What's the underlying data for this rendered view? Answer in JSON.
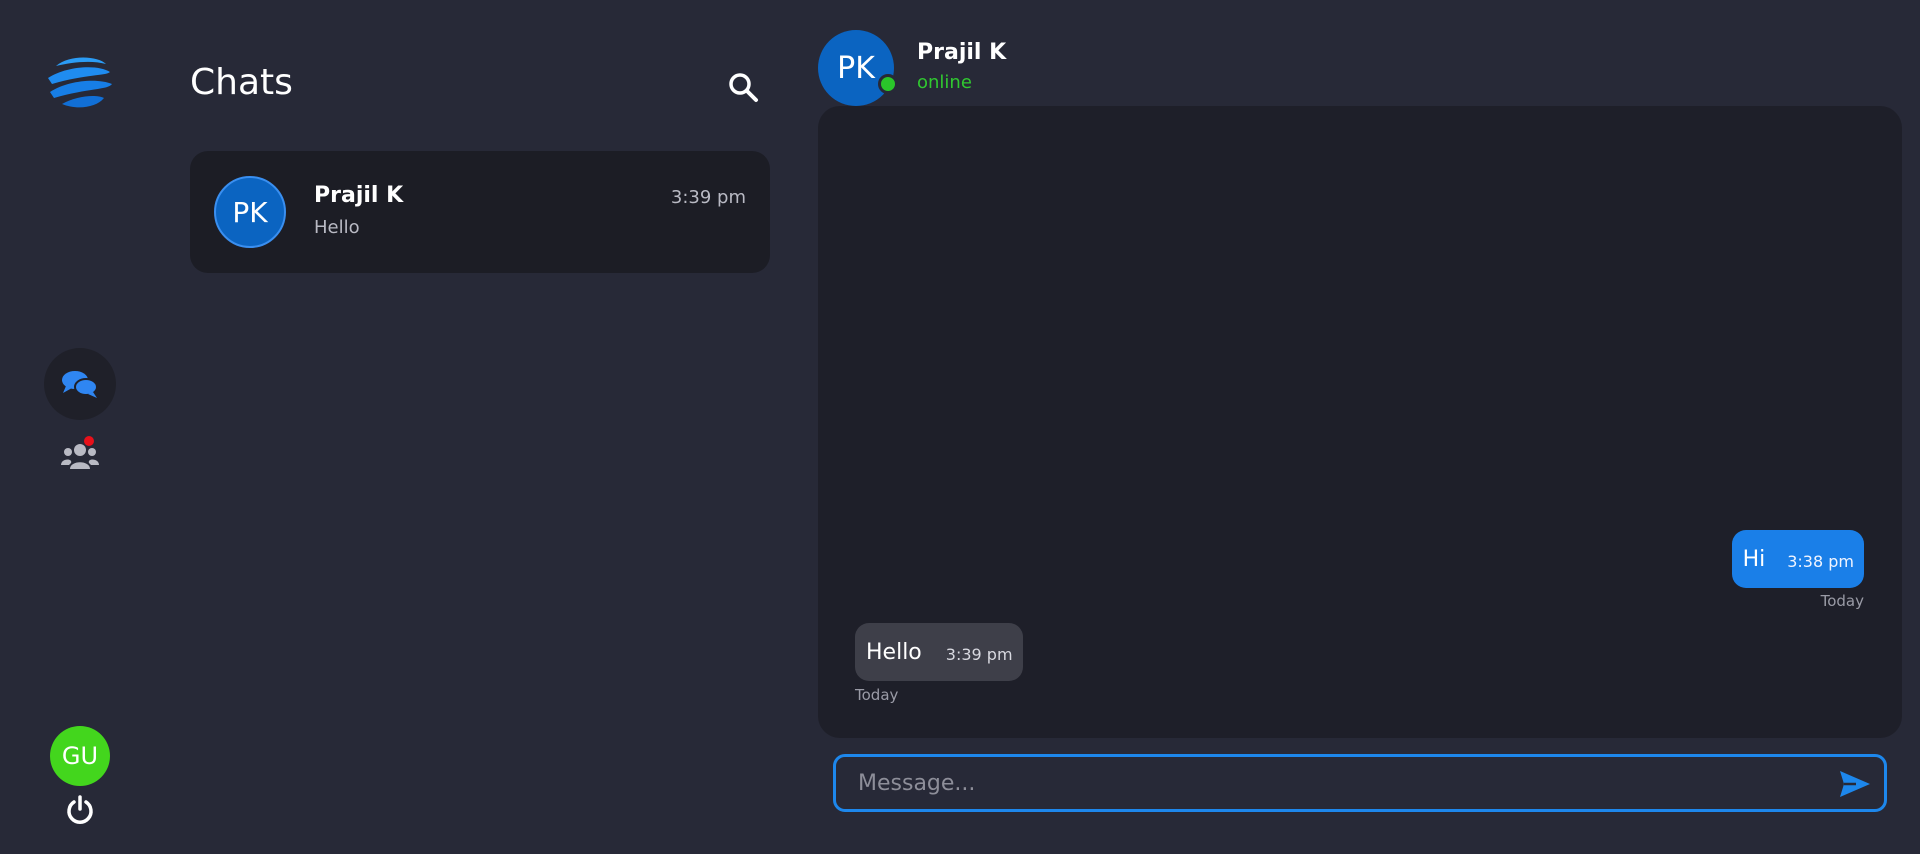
{
  "sidebar": {
    "logo": "globe-logo",
    "nav": [
      {
        "name": "chats",
        "icon": "chat-bubbles-icon",
        "active": true
      },
      {
        "name": "groups",
        "icon": "users-icon",
        "has_notification": true
      }
    ],
    "user_initials": "GU",
    "logout_icon": "power-icon"
  },
  "chats_panel": {
    "title": "Chats",
    "search_icon": "search-icon",
    "items": [
      {
        "initials": "PK",
        "name": "Prajil K",
        "preview": "Hello",
        "time": "3:39 pm"
      }
    ]
  },
  "conversation": {
    "initials": "PK",
    "name": "Prajil K",
    "status": "online",
    "messages": [
      {
        "direction": "out",
        "text": "Hi",
        "time": "3:38 pm",
        "day": "Today"
      },
      {
        "direction": "in",
        "text": "Hello",
        "time": "3:39 pm",
        "day": "Today"
      }
    ]
  },
  "composer": {
    "placeholder": "Message...",
    "value": "",
    "send_icon": "send-icon"
  },
  "colors": {
    "background": "#272937",
    "panel": "#1e1f29",
    "accent": "#1a7fe8",
    "online": "#2ac52a",
    "user_avatar": "#43d61d",
    "notification": "#e8101a"
  }
}
